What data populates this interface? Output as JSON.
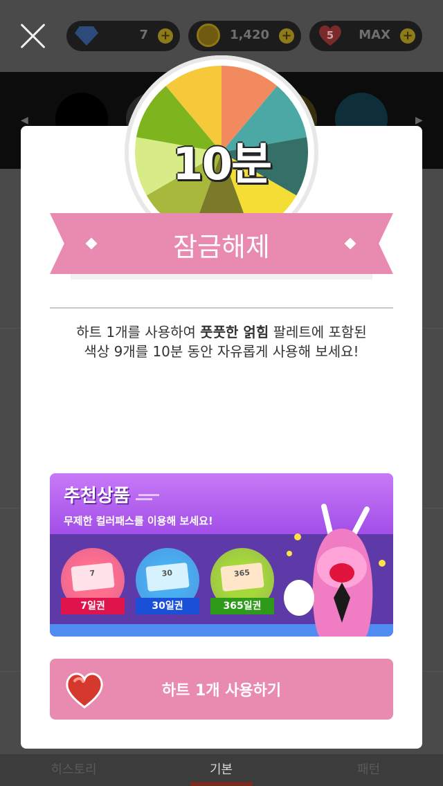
{
  "header": {
    "gem_count": "7",
    "coin_count": "1,420",
    "heart_count": "5",
    "heart_status": "MAX"
  },
  "tabs": [
    "히스토리",
    "기본",
    "패턴"
  ],
  "modal": {
    "timer_label": "10분",
    "ribbon_title": "잠금해제",
    "description_pre": "하트 1개를 사용하여 ",
    "description_bold": "풋풋한 얽힘",
    "description_post": " 팔레트에 포함된",
    "description_line2": "색상 9개를 10분 동안 자유롭게 사용해 보세요!",
    "wheel_colors": [
      "#f28a60",
      "#4ba8a4",
      "#357068",
      "#f4dd35",
      "#7a7a28",
      "#a7b83d",
      "#d7ec87",
      "#7eb51f",
      "#f5c93a"
    ],
    "promo": {
      "title": "추천상품",
      "subtitle": "무제한 컬러패스를 이용해 보세요!",
      "passes": [
        {
          "number": "7",
          "label": "7일권",
          "bg": "#ff6f8e",
          "ticket": "#ffe2ea",
          "tag": "#e0144c"
        },
        {
          "number": "30",
          "label": "30일권",
          "bg": "#4aaef0",
          "ticket": "#d7f2ff",
          "tag": "#1a4fd8"
        },
        {
          "number": "365",
          "label": "365일권",
          "bg": "#a6d83a",
          "ticket": "#ffe6c8",
          "tag": "#2e9a1a"
        }
      ]
    },
    "button_label": "하트 1개 사용하기"
  }
}
